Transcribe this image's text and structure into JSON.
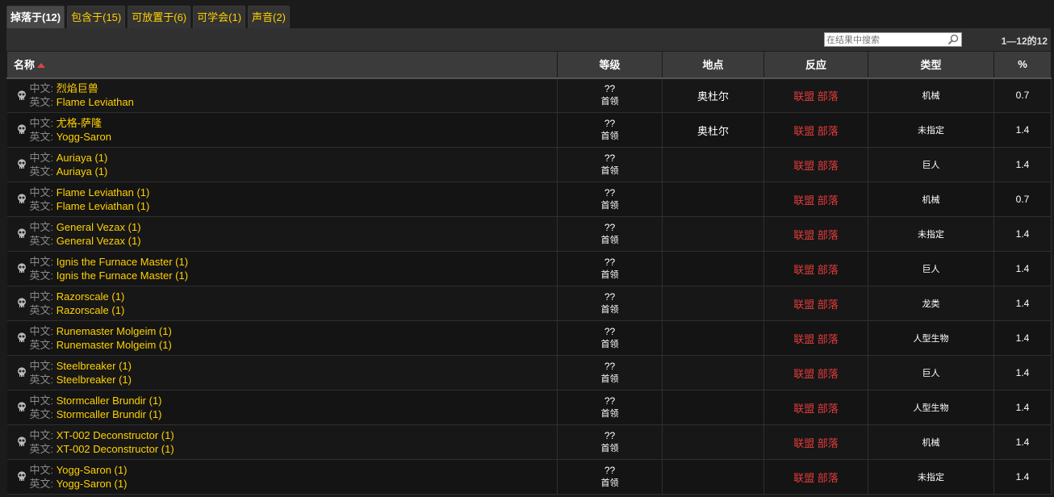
{
  "tabs": [
    {
      "label": "掉落于(12)",
      "active": true
    },
    {
      "label": "包含于(15)",
      "active": false
    },
    {
      "label": "可放置于(6)",
      "active": false
    },
    {
      "label": "可学会(1)",
      "active": false
    },
    {
      "label": "声音(2)",
      "active": false
    }
  ],
  "search": {
    "placeholder": "在结果中搜索",
    "value": ""
  },
  "pager": "1—12的12",
  "columns": {
    "name": "名称",
    "level": "等级",
    "location": "地点",
    "reaction": "反应",
    "type": "类型",
    "percent": "%"
  },
  "labels": {
    "cn": "中文:",
    "en": "英文:"
  },
  "rows": [
    {
      "cn": "烈焰巨兽",
      "en": "Flame Leviathan",
      "level": "??",
      "rank": "首领",
      "location": "奥杜尔",
      "reaction": "联盟 部落",
      "type": "机械",
      "percent": "0.7"
    },
    {
      "cn": "尤格-萨隆",
      "en": "Yogg-Saron",
      "level": "??",
      "rank": "首领",
      "location": "奥杜尔",
      "reaction": "联盟 部落",
      "type": "未指定",
      "percent": "1.4"
    },
    {
      "cn": "Auriaya (1)",
      "en": "Auriaya (1)",
      "level": "??",
      "rank": "首领",
      "location": "",
      "reaction": "联盟 部落",
      "type": "巨人",
      "percent": "1.4"
    },
    {
      "cn": "Flame Leviathan (1)",
      "en": "Flame Leviathan (1)",
      "level": "??",
      "rank": "首领",
      "location": "",
      "reaction": "联盟 部落",
      "type": "机械",
      "percent": "0.7"
    },
    {
      "cn": "General Vezax (1)",
      "en": "General Vezax (1)",
      "level": "??",
      "rank": "首领",
      "location": "",
      "reaction": "联盟 部落",
      "type": "未指定",
      "percent": "1.4"
    },
    {
      "cn": "Ignis the Furnace Master (1)",
      "en": "Ignis the Furnace Master (1)",
      "level": "??",
      "rank": "首领",
      "location": "",
      "reaction": "联盟 部落",
      "type": "巨人",
      "percent": "1.4"
    },
    {
      "cn": "Razorscale (1)",
      "en": "Razorscale (1)",
      "level": "??",
      "rank": "首领",
      "location": "",
      "reaction": "联盟 部落",
      "type": "龙类",
      "percent": "1.4"
    },
    {
      "cn": "Runemaster Molgeim (1)",
      "en": "Runemaster Molgeim (1)",
      "level": "??",
      "rank": "首领",
      "location": "",
      "reaction": "联盟 部落",
      "type": "人型生物",
      "percent": "1.4"
    },
    {
      "cn": "Steelbreaker (1)",
      "en": "Steelbreaker (1)",
      "level": "??",
      "rank": "首领",
      "location": "",
      "reaction": "联盟 部落",
      "type": "巨人",
      "percent": "1.4"
    },
    {
      "cn": "Stormcaller Brundir (1)",
      "en": "Stormcaller Brundir (1)",
      "level": "??",
      "rank": "首领",
      "location": "",
      "reaction": "联盟 部落",
      "type": "人型生物",
      "percent": "1.4"
    },
    {
      "cn": "XT-002 Deconstructor (1)",
      "en": "XT-002 Deconstructor (1)",
      "level": "??",
      "rank": "首领",
      "location": "",
      "reaction": "联盟 部落",
      "type": "机械",
      "percent": "1.4"
    },
    {
      "cn": "Yogg-Saron (1)",
      "en": "Yogg-Saron (1)",
      "level": "??",
      "rank": "首领",
      "location": "",
      "reaction": "联盟 部落",
      "type": "未指定",
      "percent": "1.4"
    }
  ]
}
